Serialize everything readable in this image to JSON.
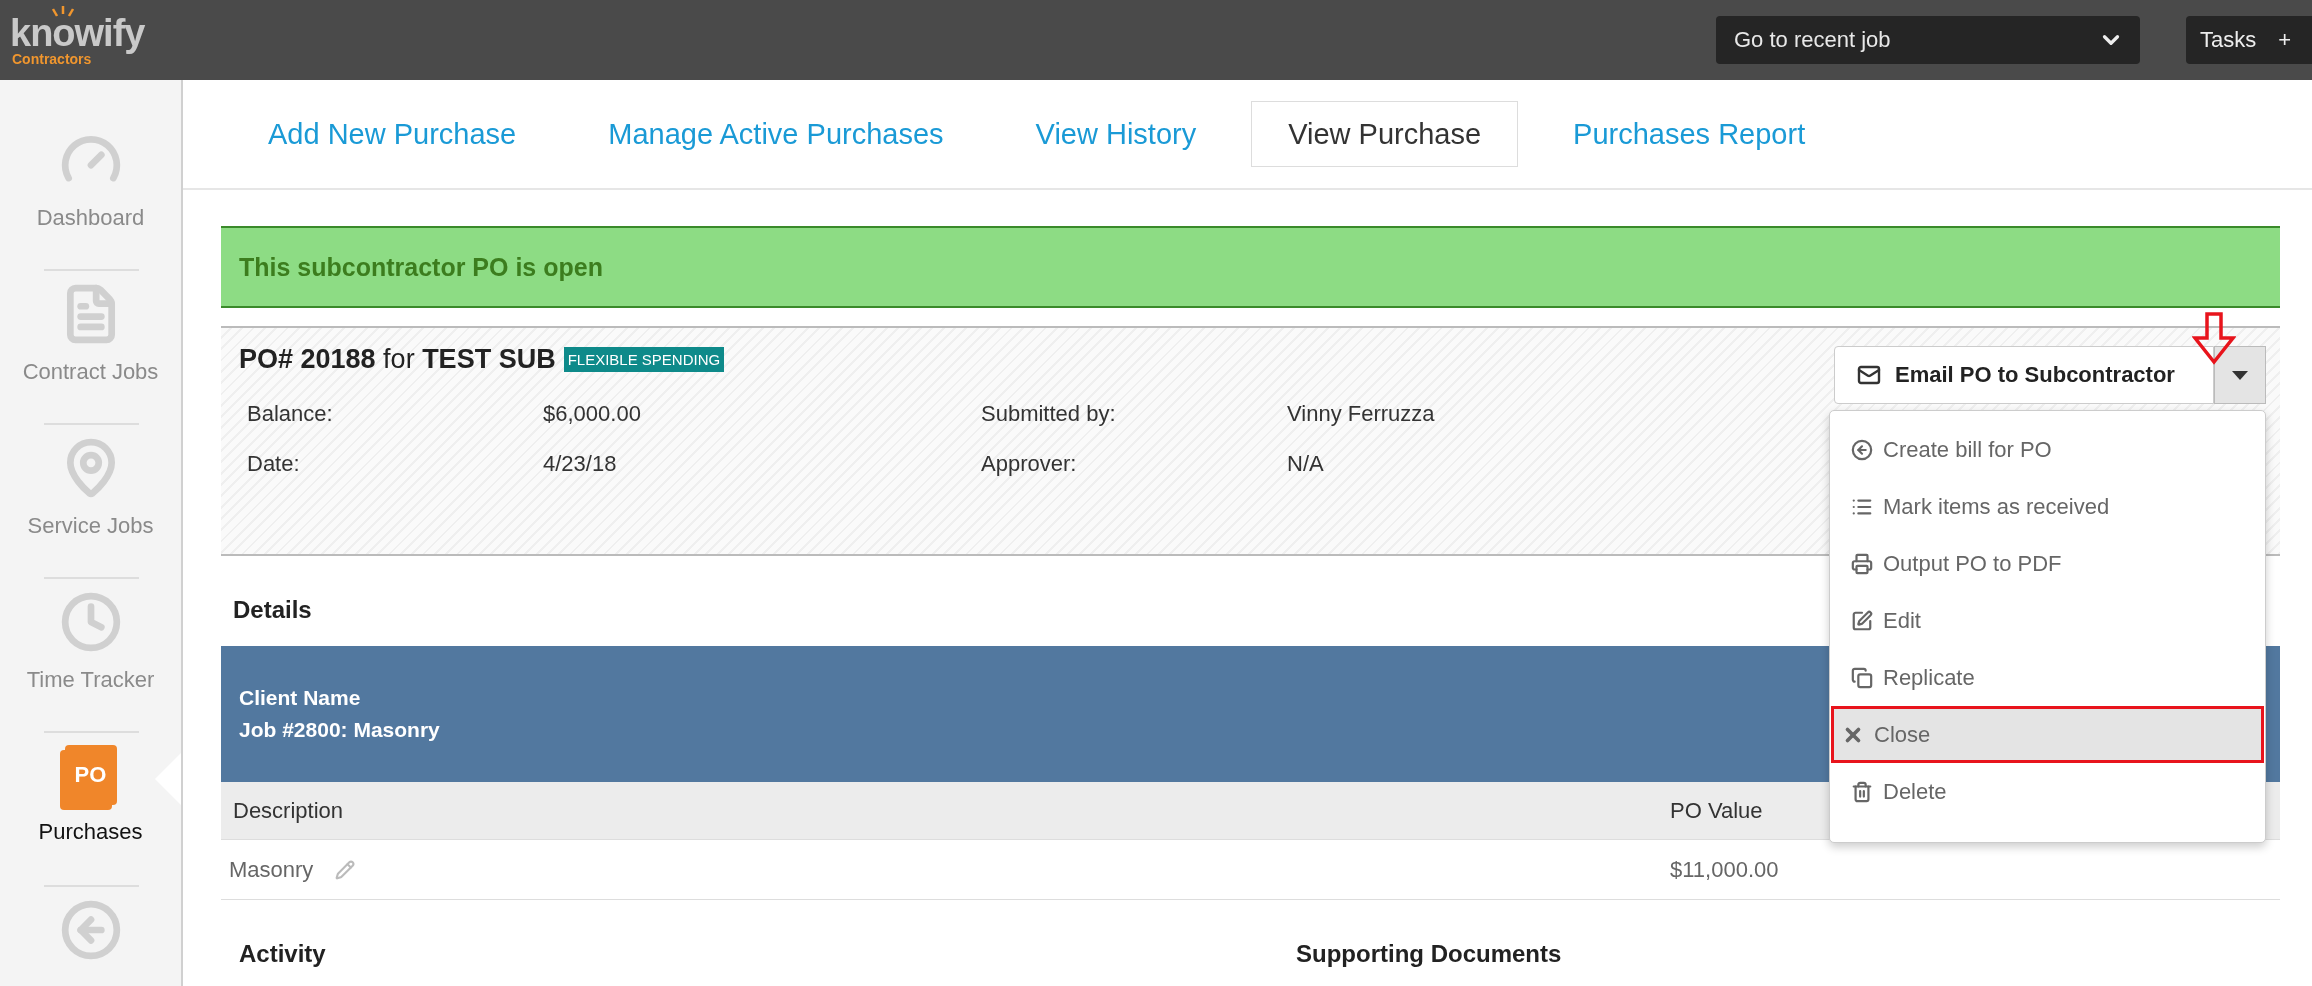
{
  "header": {
    "logo": "knowify",
    "logo_sub": "Contractors",
    "recent_job": {
      "placeholder": "Go to recent job"
    },
    "tasks": "Tasks",
    "tasks_plus": "+"
  },
  "sidebar": {
    "items": [
      {
        "kind": "gauge",
        "label": "Dashboard",
        "selected": false
      },
      {
        "kind": "document",
        "label": "Contract Jobs",
        "selected": false
      },
      {
        "kind": "pin",
        "label": "Service Jobs",
        "selected": false
      },
      {
        "kind": "clock",
        "label": "Time Tracker",
        "selected": false
      },
      {
        "kind": "badge",
        "badge": "PO",
        "label": "Purchases",
        "selected": true
      },
      {
        "kind": "back",
        "selected": false
      }
    ]
  },
  "tabs": [
    {
      "label": "Add New Purchase",
      "selected": false
    },
    {
      "label": "Manage Active Purchases",
      "selected": false
    },
    {
      "label": "View History",
      "selected": false
    },
    {
      "label": "View Purchase",
      "selected": true
    },
    {
      "label": "Purchases Report",
      "selected": false
    }
  ],
  "banner": {
    "text": "This subcontractor PO is open"
  },
  "po": {
    "title": "**PO# 20188** for **TEST SUB**",
    "tag": "FLEXIBLE SPENDING",
    "fields": [
      {
        "label": "Balance:",
        "value": "$6,000.00"
      },
      {
        "label": "Submitted by:",
        "value": "Vinny Ferruzza"
      },
      {
        "label": "Date:",
        "value": "4/23/18"
      },
      {
        "label": "Approver:",
        "value": "N/A"
      }
    ]
  },
  "actions": {
    "button": "Email PO to Subcontractor",
    "menu_open": true,
    "menu": [
      {
        "kind": "bill",
        "label": "Create bill for PO",
        "selected": false
      },
      {
        "kind": "list",
        "label": "Mark items as received",
        "selected": false
      },
      {
        "kind": "print",
        "label": "Output PO to PDF",
        "selected": false
      },
      {
        "kind": "edit",
        "label": "Edit",
        "selected": false
      },
      {
        "kind": "copy",
        "label": "Replicate",
        "selected": false
      },
      {
        "kind": "close",
        "label": "Close",
        "selected": true
      },
      {
        "kind": "delete",
        "label": "Delete",
        "selected": false
      }
    ]
  },
  "details": {
    "heading": "Details",
    "band": [
      "Client Name",
      "Job #2800: Masonry"
    ],
    "columns": [
      "Description",
      "PO Value"
    ],
    "rows": [
      {
        "description": "Masonry",
        "value": "$11,000.00"
      }
    ]
  },
  "sections": [
    "Activity",
    "Supporting Documents"
  ]
}
